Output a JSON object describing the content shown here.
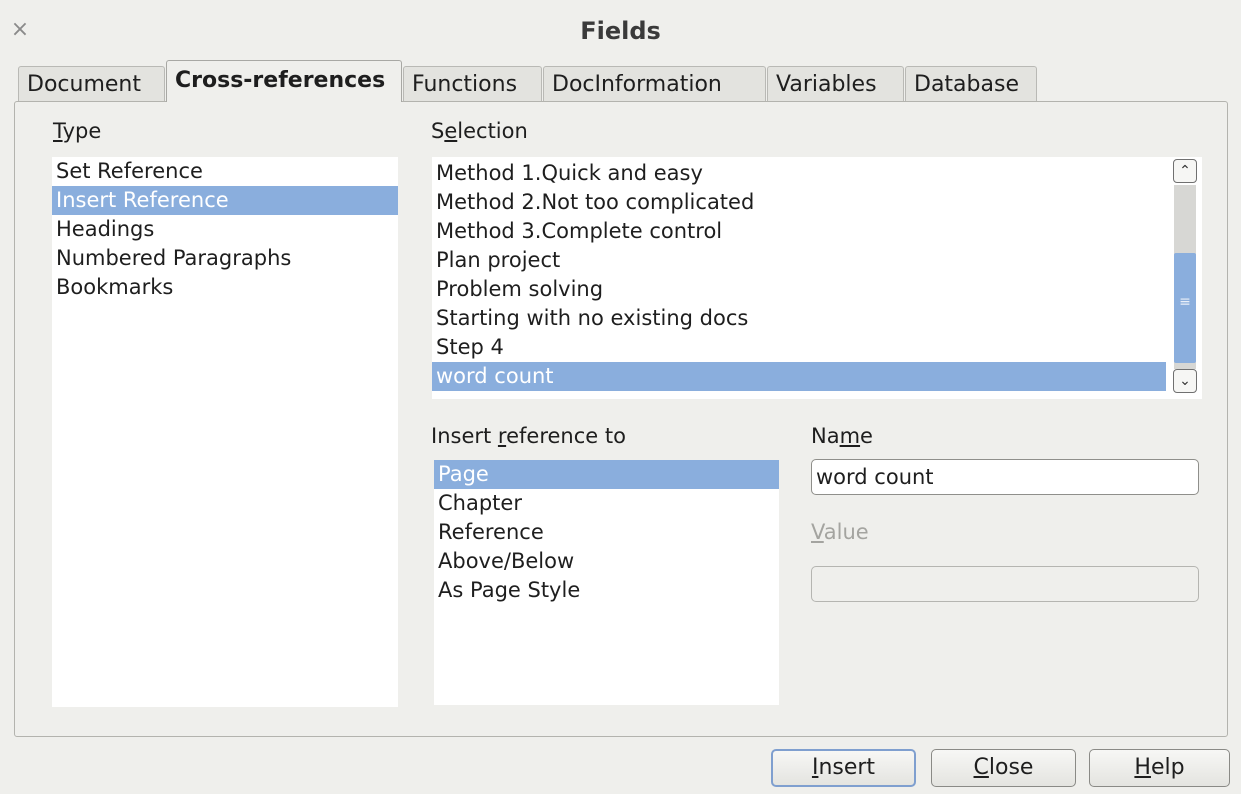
{
  "window": {
    "title": "Fields",
    "close_glyph": "×"
  },
  "tabs": [
    {
      "label": "Document"
    },
    {
      "label": "Cross-references",
      "active": true
    },
    {
      "label": "Functions"
    },
    {
      "label": "DocInformation"
    },
    {
      "label": "Variables"
    },
    {
      "label": "Database"
    }
  ],
  "type_section": {
    "label_mnemonic": "T",
    "label_rest": "ype",
    "items": [
      "Set Reference",
      "Insert Reference",
      "Headings",
      "Numbered Paragraphs",
      "Bookmarks"
    ],
    "selected": "Insert Reference"
  },
  "selection_section": {
    "label_pre": "S",
    "label_mnemonic": "e",
    "label_rest": "lection",
    "items": [
      "Method 1.Quick and easy",
      "Method 2.Not too complicated",
      "Method 3.Complete control",
      "Plan project",
      "Problem solving",
      "Starting with no existing docs",
      "Step 4",
      "word count"
    ],
    "selected": "word count",
    "scroll_position": 0.85,
    "scroll_up_glyph": "⌃",
    "scroll_down_glyph": "⌄",
    "grip_glyph": "≡"
  },
  "insert_ref_section": {
    "label_pre": "Insert ",
    "label_mnemonic": "r",
    "label_rest": "eference to",
    "items": [
      "Page",
      "Chapter",
      "Reference",
      "Above/Below",
      "As Page Style"
    ],
    "selected": "Page"
  },
  "name_field": {
    "label_pre": "Na",
    "label_mnemonic": "m",
    "label_rest": "e",
    "value": "word count"
  },
  "value_field": {
    "label_mnemonic": "V",
    "label_rest": "alue",
    "value": ""
  },
  "buttons": {
    "insert_mnemonic": "I",
    "insert_rest": "nsert",
    "close_mnemonic": "C",
    "close_rest": "lose",
    "help_mnemonic": "H",
    "help_rest": "elp"
  },
  "colors": {
    "selection": "#8aaedd",
    "dialog_bg": "#efefec"
  }
}
